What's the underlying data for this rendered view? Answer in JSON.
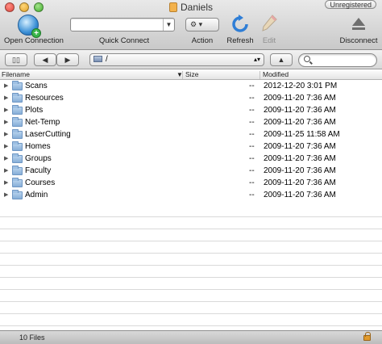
{
  "window": {
    "title": "Daniels",
    "badge": "Unregistered"
  },
  "toolbar": {
    "open_connection": "Open Connection",
    "quick_connect": "Quick Connect",
    "quick_connect_value": "",
    "action": "Action",
    "refresh": "Refresh",
    "edit": "Edit",
    "disconnect": "Disconnect"
  },
  "pathbar": {
    "path": "/",
    "search_value": ""
  },
  "columns": {
    "filename": "Filename",
    "size": "Size",
    "modified": "Modified"
  },
  "files": [
    {
      "name": "Scans",
      "size": "--",
      "modified": "2012-12-20 3:01 PM"
    },
    {
      "name": "Resources",
      "size": "--",
      "modified": "2009-11-20 7:36 AM"
    },
    {
      "name": "Plots",
      "size": "--",
      "modified": "2009-11-20 7:36 AM"
    },
    {
      "name": "Net-Temp",
      "size": "--",
      "modified": "2009-11-20 7:36 AM"
    },
    {
      "name": "LaserCutting",
      "size": "--",
      "modified": "2009-11-25 11:58 AM"
    },
    {
      "name": "Homes",
      "size": "--",
      "modified": "2009-11-20 7:36 AM"
    },
    {
      "name": "Groups",
      "size": "--",
      "modified": "2009-11-20 7:36 AM"
    },
    {
      "name": "Faculty",
      "size": "--",
      "modified": "2009-11-20 7:36 AM"
    },
    {
      "name": "Courses",
      "size": "--",
      "modified": "2009-11-20 7:36 AM"
    },
    {
      "name": "Admin",
      "size": "--",
      "modified": "2009-11-20 7:36 AM"
    }
  ],
  "status": {
    "count": "10 Files"
  }
}
